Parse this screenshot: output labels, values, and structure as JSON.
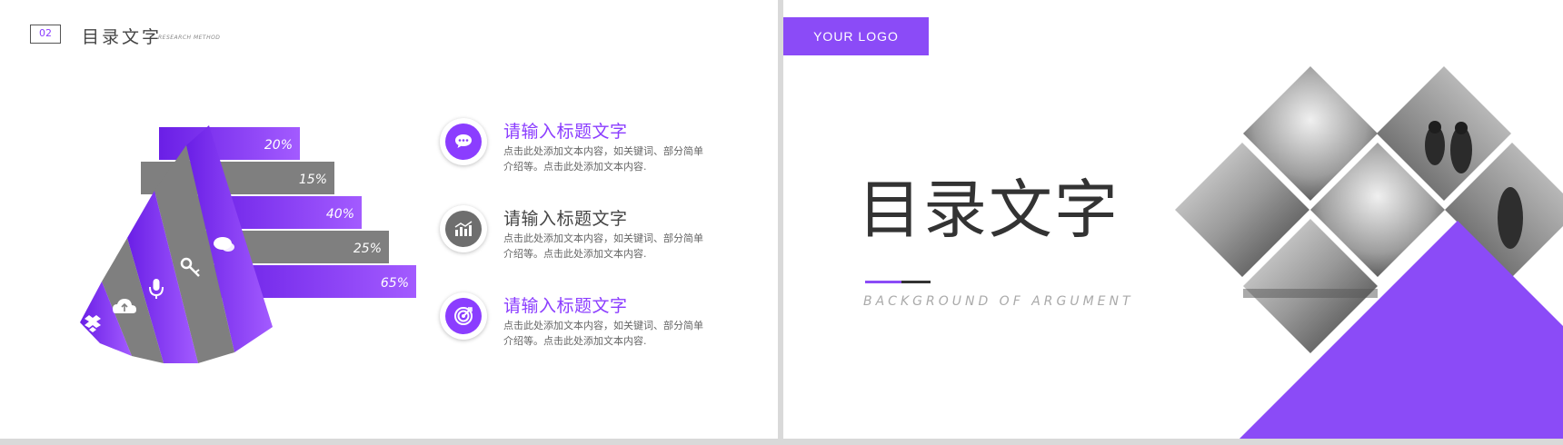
{
  "left_slide": {
    "section_number": "02",
    "section_title": "目录文字",
    "section_subtitle": "RESEARCH METHOD",
    "chart_data": {
      "type": "bar",
      "categories": [
        "",
        "",
        "",
        "",
        ""
      ],
      "values": [
        20,
        15,
        40,
        25,
        65
      ],
      "value_labels": [
        "20%",
        "15%",
        "40%",
        "25%",
        "65%"
      ],
      "colors": [
        "#8b3dff",
        "#7f7f7f",
        "#8b3dff",
        "#7f7f7f",
        "#8b3dff"
      ],
      "icons": [
        "chat-icon",
        "key-icon",
        "microphone-icon",
        "cloud-upload-icon",
        "dropbox-icon"
      ]
    },
    "items": [
      {
        "title": "请输入标题文字",
        "desc": "点击此处添加文本内容，如关键词、部分简单介绍等。点击此处添加文本内容.",
        "icon": "chat-icon",
        "color": "#8b3dff"
      },
      {
        "title": "请输入标题文字",
        "desc": "点击此处添加文本内容，如关键词、部分简单介绍等。点击此处添加文本内容.",
        "icon": "bar-chart-icon",
        "color": "#6e6e6e"
      },
      {
        "title": "请输入标题文字",
        "desc": "点击此处添加文本内容，如关键词、部分简单介绍等。点击此处添加文本内容.",
        "icon": "target-icon",
        "color": "#8b3dff"
      }
    ]
  },
  "right_slide": {
    "logo_text": "YOUR  LOGO",
    "title": "目录文字",
    "subtitle": "BACKGROUND OF ARGUMENT",
    "accent_color": "#8b4bf7"
  }
}
